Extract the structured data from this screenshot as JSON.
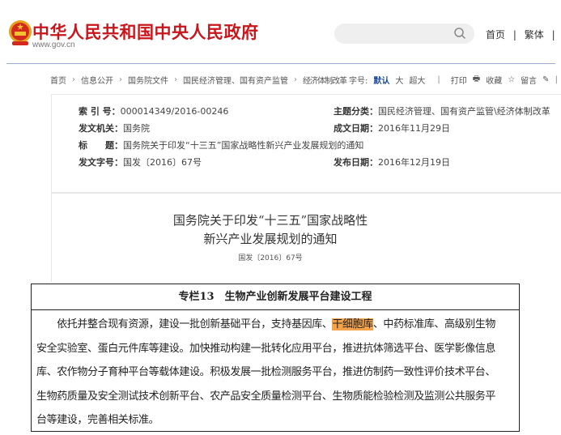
{
  "header": {
    "site_title": "中华人民共和国中央人民政府",
    "site_url": "www.gov.cn",
    "search_placeholder": "",
    "links": [
      "首页",
      "|",
      "繁体",
      "|"
    ]
  },
  "breadcrumb": {
    "items": [
      "首页",
      "信息公开",
      "国务院文件",
      "国民经济管理、国有资产监管",
      "经济体制改革"
    ],
    "font_size_label": "字号:",
    "font_sizes": [
      "默认",
      "大",
      "超大"
    ],
    "actions": {
      "print": "打印",
      "favorite": "收藏",
      "comment": "留言"
    }
  },
  "meta": {
    "index_label": "索 引 号：",
    "index_value": "000014349/2016-00246",
    "topic_label": "主题分类：",
    "topic_value": "国民经济管理、国有资产监管\\经济体制改革",
    "issuer_label": "发文机关：",
    "issuer_value": "国务院",
    "written_label": "成文日期：",
    "written_value": "2016年11月29日",
    "title_label": "标　　题：",
    "title_value": "国务院关于印发“十三五”国家战略性新兴产业发展规划的通知",
    "docno_label": "发文字号：",
    "docno_value": "国发〔2016〕67号",
    "published_label": "发布日期：",
    "published_value": "2016年12月19日"
  },
  "document": {
    "title_line1": "国务院关于印发“十三五”国家战略性",
    "title_line2": "新兴产业发展规划的通知",
    "doc_number": "国发〔2016〕67号"
  },
  "box": {
    "heading": "专栏13　生物产业创新发展平台建设工程",
    "line1_before": "　　依托并整合现有资源，建设一批创新基础平台，支持基因库、",
    "line1_highlight": "干细胞库",
    "line1_after": "、中药标准库、高级别生物",
    "line2": "安全实验室、蛋白元件库等建设。加快推动构建一批转化应用平台，推进抗体筛选平台、医学影像信息",
    "line3": "库、农作物分子育种平台等载体建设。积极发展一批检测服务平台，推进仿制药一致性评价技术平台、",
    "line4": "生物药质量及安全测试技术创新平台、农产品安全质量检测平台、生物质能检验检测及监测公共服务平",
    "line5": "台等建设，完善相关标准。",
    "highlight_color": "#f4a34a"
  }
}
